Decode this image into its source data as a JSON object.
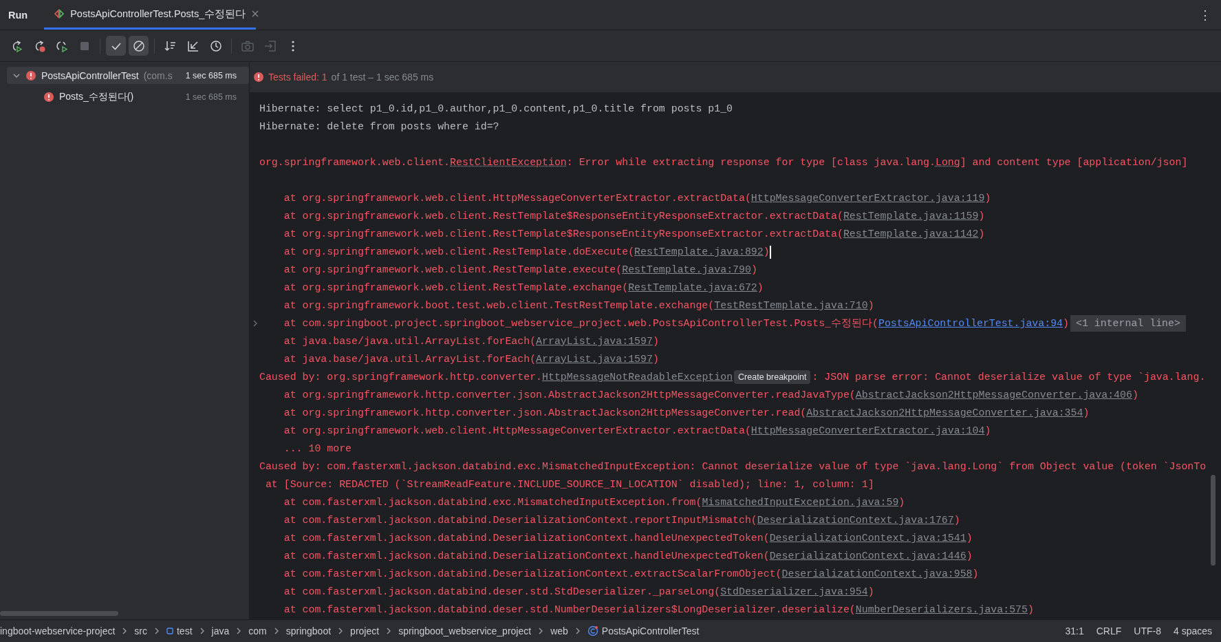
{
  "tool_window": {
    "title": "Run",
    "more": "⋮"
  },
  "tabs": [
    {
      "label": "PostsApiControllerTest.Posts_수정된다",
      "selected": true
    }
  ],
  "toolbar": [
    {
      "kind": "rerun",
      "disabled": false,
      "selected": false
    },
    {
      "kind": "rerun_failed",
      "disabled": false,
      "selected": false
    },
    {
      "kind": "toggle_auto",
      "disabled": false,
      "selected": false
    },
    {
      "kind": "stop",
      "disabled": true,
      "selected": false
    },
    {
      "kind": "show_passed",
      "disabled": false,
      "selected": true
    },
    {
      "kind": "show_ignored",
      "disabled": false,
      "selected": true
    },
    {
      "kind": "sort",
      "disabled": false,
      "selected": false
    },
    {
      "kind": "import",
      "disabled": false,
      "selected": false
    },
    {
      "kind": "history",
      "disabled": false,
      "selected": false
    },
    {
      "kind": "camera",
      "disabled": true,
      "selected": false
    },
    {
      "kind": "export",
      "disabled": true,
      "selected": false
    },
    {
      "kind": "more",
      "disabled": false,
      "selected": false
    }
  ],
  "tree": [
    {
      "name": "PostsApiControllerTest",
      "package": "(com.s",
      "time": "1 sec 685 ms",
      "failed": true,
      "expanded": true,
      "selected": true,
      "children": [
        {
          "name": "Posts_수정된다()",
          "time": "1 sec 685 ms",
          "failed": true,
          "selected": false
        }
      ]
    }
  ],
  "summary": {
    "failed": true,
    "headline": "Tests failed: 1",
    "detail": "of 1 test – 1 sec 685 ms"
  },
  "console": [
    {
      "kind": "message",
      "segments": [
        {
          "kind": "out",
          "text": "Hibernate: select p1_0.id,p1_0.author,p1_0.content,p1_0.title from posts p1_0"
        }
      ]
    },
    {
      "kind": "message",
      "segments": [
        {
          "kind": "out",
          "text": "Hibernate: delete from posts where id=?"
        }
      ]
    },
    {
      "kind": "blank"
    },
    {
      "kind": "message",
      "segments": [
        {
          "kind": "err",
          "text": "org.springframework.web.client."
        },
        {
          "kind": "class",
          "text": "RestClientException"
        },
        {
          "kind": "err",
          "text": ": Error while extracting response for type [class java.lang."
        },
        {
          "kind": "class",
          "text": "Long"
        },
        {
          "kind": "err",
          "text": "] and content type [application/json]"
        }
      ]
    },
    {
      "kind": "blank"
    },
    {
      "kind": "frame",
      "segments": [
        {
          "kind": "err",
          "text": "at org.springframework.web.client.HttpMessageConverterExtractor.extractData("
        },
        {
          "kind": "link",
          "text": "HttpMessageConverterExtractor.java:119"
        },
        {
          "kind": "err",
          "text": ")"
        }
      ]
    },
    {
      "kind": "frame",
      "segments": [
        {
          "kind": "err",
          "text": "at org.springframework.web.client.RestTemplate$ResponseEntityResponseExtractor.extractData("
        },
        {
          "kind": "link",
          "text": "RestTemplate.java:1159"
        },
        {
          "kind": "err",
          "text": ")"
        }
      ]
    },
    {
      "kind": "frame",
      "segments": [
        {
          "kind": "err",
          "text": "at org.springframework.web.client.RestTemplate$ResponseEntityResponseExtractor.extractData("
        },
        {
          "kind": "link",
          "text": "RestTemplate.java:1142"
        },
        {
          "kind": "err",
          "text": ")"
        }
      ]
    },
    {
      "kind": "frame",
      "caret": true,
      "segments": [
        {
          "kind": "err",
          "text": "at org.springframework.web.client.RestTemplate.doExecute("
        },
        {
          "kind": "link",
          "text": "RestTemplate.java:892"
        },
        {
          "kind": "err",
          "text": ")"
        }
      ]
    },
    {
      "kind": "frame",
      "segments": [
        {
          "kind": "err",
          "text": "at org.springframework.web.client.RestTemplate.execute("
        },
        {
          "kind": "link",
          "text": "RestTemplate.java:790"
        },
        {
          "kind": "err",
          "text": ")"
        }
      ]
    },
    {
      "kind": "frame",
      "segments": [
        {
          "kind": "err",
          "text": "at org.springframework.web.client.RestTemplate.exchange("
        },
        {
          "kind": "link",
          "text": "RestTemplate.java:672"
        },
        {
          "kind": "err",
          "text": ")"
        }
      ]
    },
    {
      "kind": "frame",
      "segments": [
        {
          "kind": "err",
          "text": "at org.springframework.boot.test.web.client.TestRestTemplate.exchange("
        },
        {
          "kind": "link",
          "text": "TestRestTemplate.java:710"
        },
        {
          "kind": "err",
          "text": ")"
        }
      ]
    },
    {
      "kind": "frame",
      "foldable": true,
      "segments": [
        {
          "kind": "err",
          "text": "at com.springboot.project.springboot_webservice_project.web.PostsApiControllerTest.Posts_수정된다("
        },
        {
          "kind": "link_focus",
          "text": "PostsApiControllerTest.java:94"
        },
        {
          "kind": "err",
          "text": ")"
        },
        {
          "kind": "fold",
          "text": "<1 internal line>"
        }
      ]
    },
    {
      "kind": "frame",
      "segments": [
        {
          "kind": "err",
          "text": "at java.base/java.util.ArrayList.forEach("
        },
        {
          "kind": "link",
          "text": "ArrayList.java:1597"
        },
        {
          "kind": "err",
          "text": ")"
        }
      ]
    },
    {
      "kind": "frame",
      "segments": [
        {
          "kind": "err",
          "text": "at java.base/java.util.ArrayList.forEach("
        },
        {
          "kind": "link",
          "text": "ArrayList.java:1597"
        },
        {
          "kind": "err",
          "text": ")"
        }
      ]
    },
    {
      "kind": "message",
      "segments": [
        {
          "kind": "err",
          "text": "Caused by: org.springframework.http.converter."
        },
        {
          "kind": "link",
          "text": "HttpMessageNotReadableException"
        },
        {
          "kind": "tooltip",
          "text": "Create breakpoint"
        },
        {
          "kind": "err",
          "text": ": JSON parse error: Cannot deserialize value of type `java.lang."
        }
      ]
    },
    {
      "kind": "frame",
      "segments": [
        {
          "kind": "err",
          "text": "at org.springframework.http.converter.json.AbstractJackson2HttpMessageConverter.readJavaType("
        },
        {
          "kind": "link",
          "text": "AbstractJackson2HttpMessageConverter.java:406"
        },
        {
          "kind": "err",
          "text": ")"
        }
      ]
    },
    {
      "kind": "frame",
      "segments": [
        {
          "kind": "err",
          "text": "at org.springframework.http.converter.json.AbstractJackson2HttpMessageConverter.read("
        },
        {
          "kind": "link",
          "text": "AbstractJackson2HttpMessageConverter.java:354"
        },
        {
          "kind": "err",
          "text": ")"
        }
      ]
    },
    {
      "kind": "frame",
      "segments": [
        {
          "kind": "err",
          "text": "at org.springframework.web.client.HttpMessageConverterExtractor.extractData("
        },
        {
          "kind": "link",
          "text": "HttpMessageConverterExtractor.java:104"
        },
        {
          "kind": "err",
          "text": ")"
        }
      ]
    },
    {
      "kind": "frame",
      "segments": [
        {
          "kind": "err",
          "text": "... 10 more"
        }
      ]
    },
    {
      "kind": "message",
      "segments": [
        {
          "kind": "err",
          "text": "Caused by: com.fasterxml.jackson.databind.exc.MismatchedInputException: Cannot deserialize value of type `java.lang.Long` from Object value (token `JsonTo"
        }
      ]
    },
    {
      "kind": "source",
      "segments": [
        {
          "kind": "err",
          "text": "at [Source: REDACTED (`StreamReadFeature.INCLUDE_SOURCE_IN_LOCATION` disabled); line: 1, column: 1]"
        }
      ]
    },
    {
      "kind": "frame",
      "segments": [
        {
          "kind": "err",
          "text": "at com.fasterxml.jackson.databind.exc.MismatchedInputException.from("
        },
        {
          "kind": "link",
          "text": "MismatchedInputException.java:59"
        },
        {
          "kind": "err",
          "text": ")"
        }
      ]
    },
    {
      "kind": "frame",
      "segments": [
        {
          "kind": "err",
          "text": "at com.fasterxml.jackson.databind.DeserializationContext.reportInputMismatch("
        },
        {
          "kind": "link",
          "text": "DeserializationContext.java:1767"
        },
        {
          "kind": "err",
          "text": ")"
        }
      ]
    },
    {
      "kind": "frame",
      "segments": [
        {
          "kind": "err",
          "text": "at com.fasterxml.jackson.databind.DeserializationContext.handleUnexpectedToken("
        },
        {
          "kind": "link",
          "text": "DeserializationContext.java:1541"
        },
        {
          "kind": "err",
          "text": ")"
        }
      ]
    },
    {
      "kind": "frame",
      "segments": [
        {
          "kind": "err",
          "text": "at com.fasterxml.jackson.databind.DeserializationContext.handleUnexpectedToken("
        },
        {
          "kind": "link",
          "text": "DeserializationContext.java:1446"
        },
        {
          "kind": "err",
          "text": ")"
        }
      ]
    },
    {
      "kind": "frame",
      "segments": [
        {
          "kind": "err",
          "text": "at com.fasterxml.jackson.databind.DeserializationContext.extractScalarFromObject("
        },
        {
          "kind": "link",
          "text": "DeserializationContext.java:958"
        },
        {
          "kind": "err",
          "text": ")"
        }
      ]
    },
    {
      "kind": "frame",
      "segments": [
        {
          "kind": "err",
          "text": "at com.fasterxml.jackson.databind.deser.std.StdDeserializer._parseLong("
        },
        {
          "kind": "link",
          "text": "StdDeserializer.java:954"
        },
        {
          "kind": "err",
          "text": ")"
        }
      ]
    },
    {
      "kind": "frame",
      "segments": [
        {
          "kind": "err",
          "text": "at com.fasterxml.jackson.databind.deser.std.NumberDeserializers$LongDeserializer.deserialize("
        },
        {
          "kind": "link",
          "text": "NumberDeserializers.java:575"
        },
        {
          "kind": "err",
          "text": ")"
        }
      ]
    }
  ],
  "status_bar": {
    "breadcrumbs": [
      {
        "label": "ingboot-webservice-project",
        "kind": "module"
      },
      {
        "label": "src",
        "kind": "folder"
      },
      {
        "label": "test",
        "kind": "test_folder"
      },
      {
        "label": "java",
        "kind": "folder"
      },
      {
        "label": "com",
        "kind": "folder"
      },
      {
        "label": "springboot",
        "kind": "folder"
      },
      {
        "label": "project",
        "kind": "folder"
      },
      {
        "label": "springboot_webservice_project",
        "kind": "folder"
      },
      {
        "label": "web",
        "kind": "folder"
      },
      {
        "label": "PostsApiControllerTest",
        "kind": "class"
      }
    ],
    "position": "31:1",
    "line_separator": "CRLF",
    "encoding": "UTF-8",
    "indent": "4 spaces"
  }
}
